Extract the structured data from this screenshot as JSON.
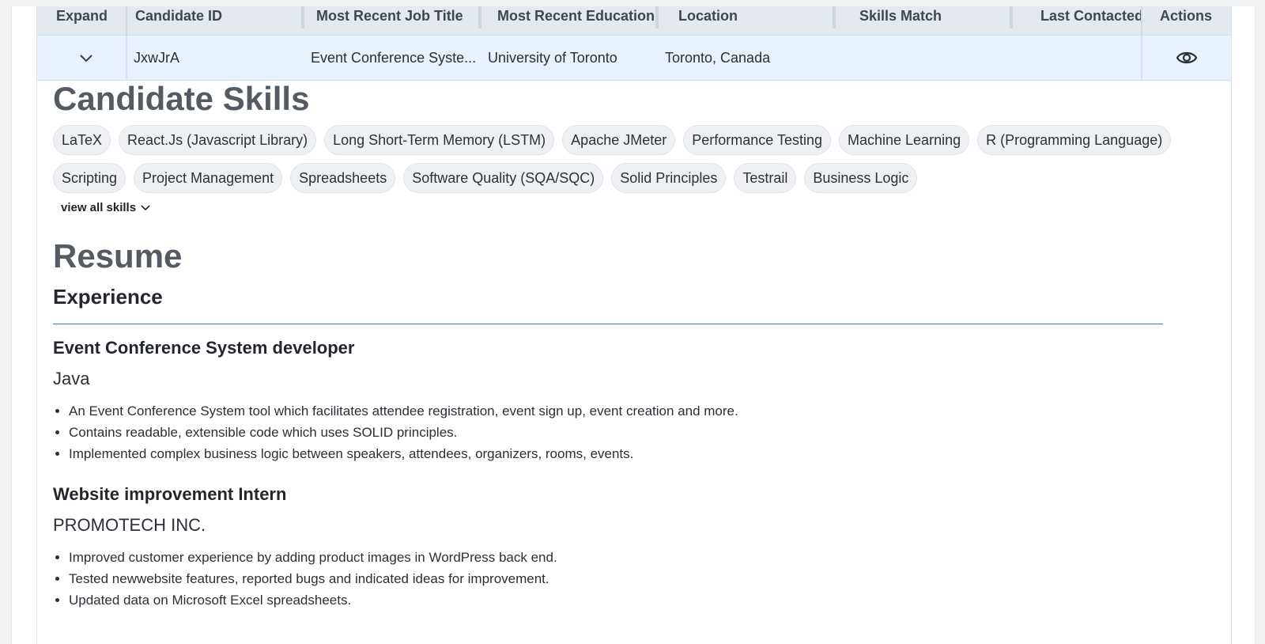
{
  "table": {
    "headers": {
      "expand": "Expand",
      "candidate_id": "Candidate ID",
      "job_title": "Most Recent Job Title",
      "education": "Most Recent Education",
      "location": "Location",
      "skills_match": "Skills Match",
      "last_contacted": "Last Contacted",
      "actions": "Actions"
    },
    "row": {
      "candidate_id": "JxwJrA",
      "job_title": "Event Conference Syste...",
      "education": "University of Toronto",
      "location": "Toronto, Canada",
      "skills_match": "",
      "last_contacted": ""
    }
  },
  "skills": {
    "heading": "Candidate Skills",
    "items": [
      "LaTeX",
      "React.Js (Javascript Library)",
      "Long Short-Term Memory (LSTM)",
      "Apache JMeter",
      "Performance Testing",
      "Machine Learning",
      "R (Programming Language)",
      "Scripting",
      "Project Management",
      "Spreadsheets",
      "Software Quality (SQA/SQC)",
      "Solid Principles",
      "Testrail",
      "Business Logic"
    ],
    "view_all": "view all skills"
  },
  "resume": {
    "heading": "Resume",
    "section": "Experience",
    "jobs": [
      {
        "title": "Event Conference System developer",
        "org": "Java",
        "bullets": [
          "An Event Conference System tool which facilitates attendee registration, event sign up, event creation and more.",
          "Contains readable, extensible code which uses SOLID principles.",
          "Implemented complex business logic between speakers, attendees, organizers, rooms, events."
        ]
      },
      {
        "title": "Website improvement Intern",
        "org": "PROMOTECH INC.",
        "bullets": [
          "Improved customer experience by adding product images in WordPress back end.",
          "Tested newwebsite features, reported bugs and indicated ideas for improvement.",
          "Updated data on Microsoft Excel spreadsheets."
        ]
      }
    ]
  },
  "icons": {
    "expand": "chevron-down-icon",
    "view": "eye-icon",
    "view_all": "chevron-down-icon"
  },
  "colors": {
    "header_bg": "#e4e9ef",
    "row_bg": "#e6f2fd",
    "chip_bg": "#eef0f4",
    "rule": "#3f78b0"
  }
}
